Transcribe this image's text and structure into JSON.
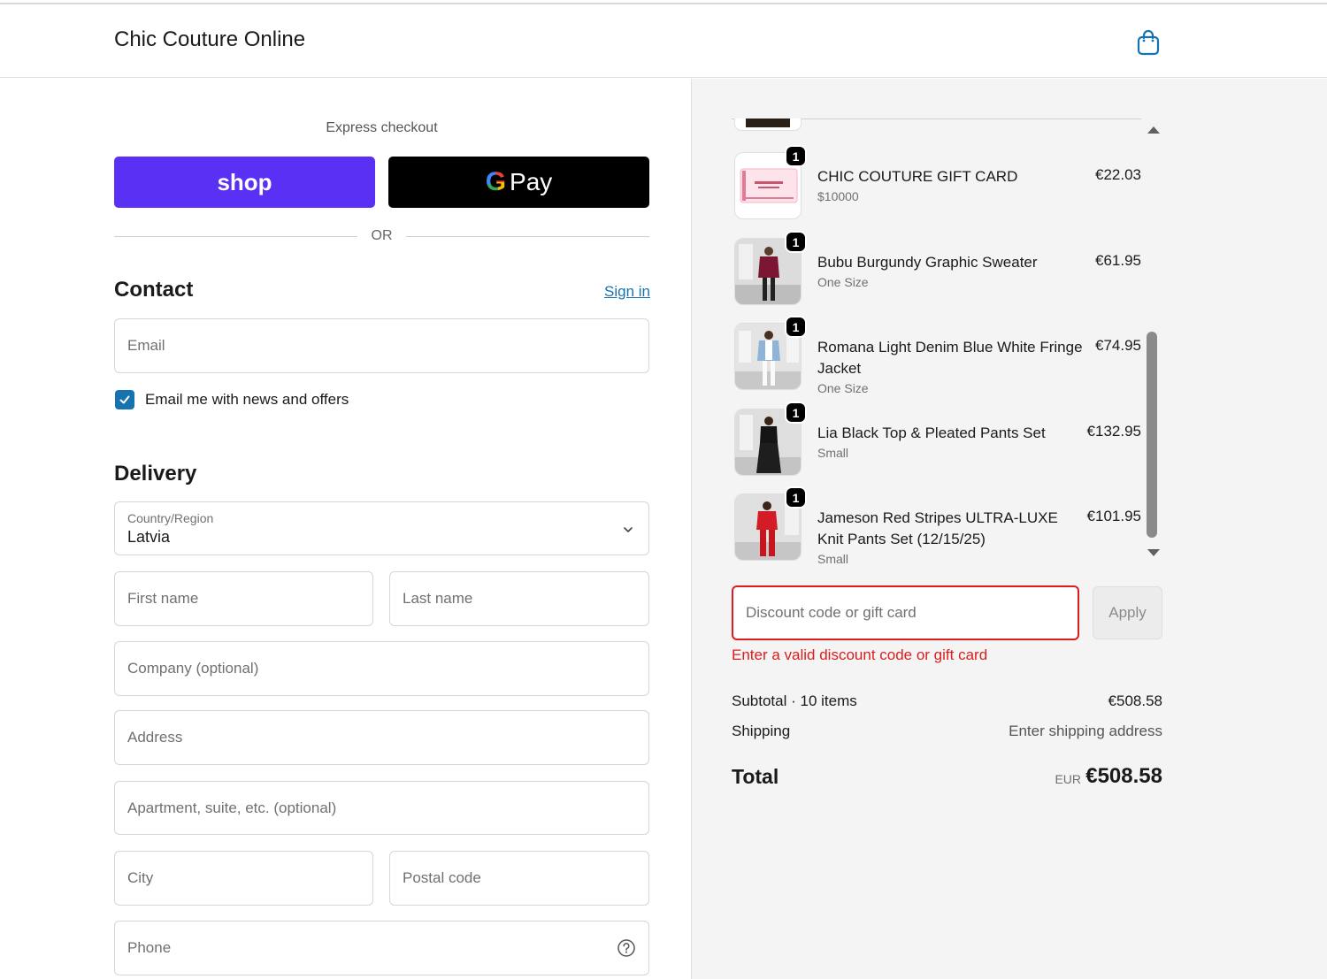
{
  "header": {
    "store_name": "Chic Couture Online",
    "cart_icon": "shopping-bag-icon"
  },
  "express": {
    "label": "Express checkout",
    "shop_label": "shop",
    "gpay_g": "G",
    "gpay_label": "Pay",
    "separator": "OR",
    "shop_color": "#5a31f4"
  },
  "contact": {
    "title": "Contact",
    "sign_in": "Sign in",
    "email_placeholder": "Email",
    "newsletter_label": "Email me with news and offers",
    "newsletter_checked": true
  },
  "delivery": {
    "title": "Delivery",
    "country_caption": "Country/Region",
    "country_value": "Latvia",
    "first_name_placeholder": "First name",
    "last_name_placeholder": "Last name",
    "company_placeholder": "Company (optional)",
    "address_placeholder": "Address",
    "apartment_placeholder": "Apartment, suite, etc. (optional)",
    "city_placeholder": "City",
    "postal_placeholder": "Postal code",
    "phone_placeholder": "Phone"
  },
  "cart": {
    "items": [
      {
        "name": "CHIC COUTURE GIFT CARD",
        "variant": "$10000",
        "price": "€22.03",
        "qty": "1"
      },
      {
        "name": "Bubu Burgundy Graphic Sweater",
        "variant": "One Size",
        "price": "€61.95",
        "qty": "1"
      },
      {
        "name": "Romana Light Denim Blue White Fringe Jacket",
        "variant": "One Size",
        "price": "€74.95",
        "qty": "1"
      },
      {
        "name": "Lia Black Top & Pleated Pants Set",
        "variant": "Small",
        "price": "€132.95",
        "qty": "1"
      },
      {
        "name": "Jameson Red Stripes ULTRA-LUXE Knit Pants Set (12/15/25)",
        "variant": "Small",
        "price": "€101.95",
        "qty": "1"
      }
    ],
    "scroll_position": 0.55
  },
  "discount": {
    "placeholder": "Discount code or gift card",
    "apply_label": "Apply",
    "error": "Enter a valid discount code or gift card",
    "error_color": "#dd1d1d"
  },
  "summary": {
    "subtotal_label": "Subtotal · 10 items",
    "subtotal_value": "€508.58",
    "shipping_label": "Shipping",
    "shipping_value": "Enter shipping address",
    "total_label": "Total",
    "total_currency": "EUR",
    "total_value": "€508.58"
  }
}
